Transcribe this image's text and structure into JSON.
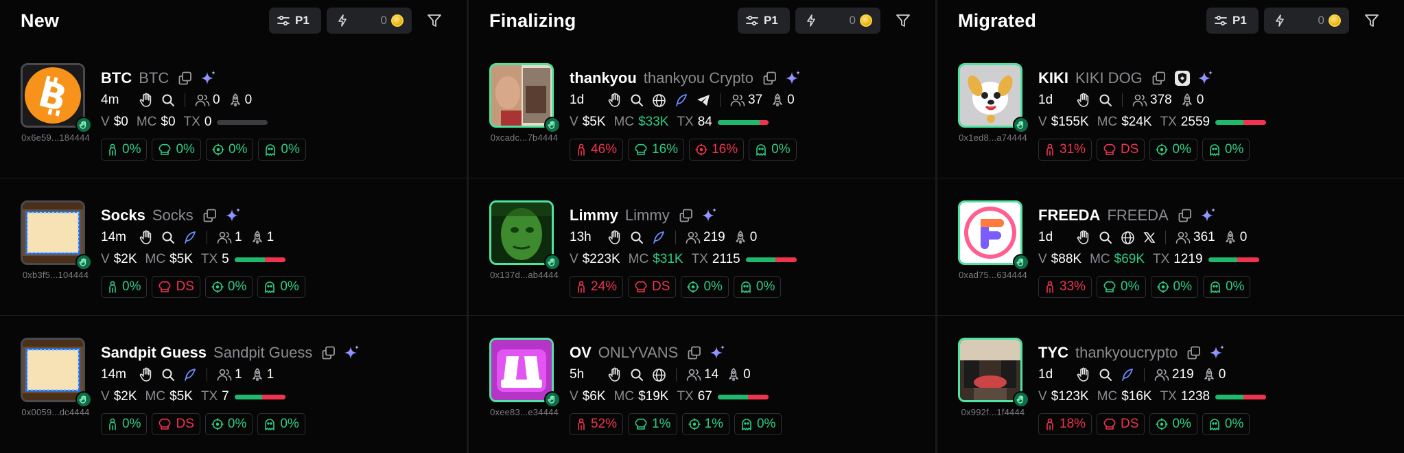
{
  "toolbar": {
    "preset_label": "P1",
    "bolt_value": "0"
  },
  "columns": [
    {
      "title": "New",
      "tokens": [
        {
          "ticker": "BTC",
          "name": "BTC",
          "address": "0x6e59...184444",
          "age": "4m",
          "socials": [
            "search"
          ],
          "holders": "0",
          "snipers": "0",
          "v": "$0",
          "mc": "$0",
          "mc_green": false,
          "tx": "0",
          "buy_ratio": 0,
          "sell_ratio": 0,
          "chip1": "0%",
          "chip2": "0%",
          "chip3": "0%",
          "chip4": "0%",
          "chip1_neg": false,
          "chip2_neg": false,
          "chip3_neg": false,
          "chip4_neg": false,
          "avatar": "btc",
          "border": "grey",
          "chip2_ds": false
        },
        {
          "ticker": "Socks",
          "name": "Socks",
          "address": "0xb3f5...104444",
          "age": "14m",
          "socials": [
            "search",
            "feather"
          ],
          "holders": "1",
          "snipers": "1",
          "v": "$2K",
          "mc": "$5K",
          "mc_green": false,
          "tx": "5",
          "buy_ratio": 0.6,
          "sell_ratio": 0.4,
          "chip1": "0%",
          "chip2": "DS",
          "chip3": "0%",
          "chip4": "0%",
          "chip1_neg": false,
          "chip2_neg": true,
          "chip3_neg": false,
          "chip4_neg": false,
          "avatar": "paper",
          "border": "grey",
          "chip2_ds": true
        },
        {
          "ticker": "Sandpit Guess",
          "name": "Sandpit Guess",
          "address": "0x0059...dc4444",
          "age": "14m",
          "socials": [
            "search",
            "feather"
          ],
          "holders": "1",
          "snipers": "1",
          "v": "$2K",
          "mc": "$5K",
          "mc_green": false,
          "tx": "7",
          "buy_ratio": 0.55,
          "sell_ratio": 0.45,
          "chip1": "0%",
          "chip2": "DS",
          "chip3": "0%",
          "chip4": "0%",
          "chip1_neg": false,
          "chip2_neg": true,
          "chip3_neg": false,
          "chip4_neg": false,
          "avatar": "paper",
          "border": "grey",
          "chip2_ds": true
        }
      ]
    },
    {
      "title": "Finalizing",
      "tokens": [
        {
          "ticker": "thankyou",
          "name": "thankyou Crypto",
          "address": "0xcadc...7b4444",
          "age": "1d",
          "socials": [
            "search",
            "globe",
            "feather",
            "telegram"
          ],
          "holders": "37",
          "snipers": "0",
          "v": "$5K",
          "mc": "$33K",
          "mc_green": true,
          "tx": "84",
          "buy_ratio": 0.82,
          "sell_ratio": 0.18,
          "chip1": "46%",
          "chip2": "16%",
          "chip3": "16%",
          "chip4": "0%",
          "chip1_neg": true,
          "chip2_neg": false,
          "chip3_neg": true,
          "chip4_neg": false,
          "avatar": "photo1",
          "border": "green",
          "chip2_ds": false
        },
        {
          "ticker": "Limmy",
          "name": "Limmy",
          "address": "0x137d...ab4444",
          "age": "13h",
          "socials": [
            "search",
            "feather"
          ],
          "holders": "219",
          "snipers": "0",
          "v": "$223K",
          "mc": "$31K",
          "mc_green": true,
          "tx": "2115",
          "buy_ratio": 0.58,
          "sell_ratio": 0.42,
          "chip1": "24%",
          "chip2": "DS",
          "chip3": "0%",
          "chip4": "0%",
          "chip1_neg": true,
          "chip2_neg": true,
          "chip3_neg": false,
          "chip4_neg": false,
          "avatar": "limmy",
          "border": "green",
          "chip2_ds": true
        },
        {
          "ticker": "OV",
          "name": "ONLYVANS",
          "address": "0xee83...e34444",
          "age": "5h",
          "socials": [
            "search",
            "globe"
          ],
          "holders": "14",
          "snipers": "0",
          "v": "$6K",
          "mc": "$19K",
          "mc_green": false,
          "tx": "67",
          "buy_ratio": 0.6,
          "sell_ratio": 0.4,
          "chip1": "52%",
          "chip2": "1%",
          "chip3": "1%",
          "chip4": "0%",
          "chip1_neg": true,
          "chip2_neg": false,
          "chip3_neg": false,
          "chip4_neg": false,
          "avatar": "ov",
          "border": "green",
          "chip2_ds": false
        }
      ]
    },
    {
      "title": "Migrated",
      "tokens": [
        {
          "ticker": "KIKI",
          "name": "KIKI DOG",
          "address": "0x1ed8...a74444",
          "age": "1d",
          "socials": [
            "search"
          ],
          "holders": "378",
          "snipers": "0",
          "v": "$155K",
          "mc": "$24K",
          "mc_green": false,
          "tx": "2559",
          "buy_ratio": 0.55,
          "sell_ratio": 0.45,
          "chip1": "31%",
          "chip2": "DS",
          "chip3": "0%",
          "chip4": "0%",
          "chip1_neg": true,
          "chip2_neg": true,
          "chip3_neg": false,
          "chip4_neg": false,
          "avatar": "dog",
          "border": "green",
          "chip2_ds": true,
          "shield": true
        },
        {
          "ticker": "FREEDA",
          "name": "FREEDA",
          "address": "0xad75...634444",
          "age": "1d",
          "socials": [
            "search",
            "globe",
            "x"
          ],
          "holders": "361",
          "snipers": "0",
          "v": "$88K",
          "mc": "$69K",
          "mc_green": true,
          "tx": "1219",
          "buy_ratio": 0.58,
          "sell_ratio": 0.42,
          "chip1": "33%",
          "chip2": "0%",
          "chip3": "0%",
          "chip4": "0%",
          "chip1_neg": true,
          "chip2_neg": false,
          "chip3_neg": false,
          "chip4_neg": false,
          "avatar": "freeda",
          "border": "green",
          "chip2_ds": false
        },
        {
          "ticker": "TYC",
          "name": "thankyoucrypto",
          "address": "0x992f...1f4444",
          "age": "1d",
          "socials": [
            "search",
            "feather"
          ],
          "holders": "219",
          "snipers": "0",
          "v": "$123K",
          "mc": "$16K",
          "mc_green": false,
          "tx": "1238",
          "buy_ratio": 0.55,
          "sell_ratio": 0.45,
          "chip1": "18%",
          "chip2": "DS",
          "chip3": "0%",
          "chip4": "0%",
          "chip1_neg": true,
          "chip2_neg": true,
          "chip3_neg": false,
          "chip4_neg": false,
          "avatar": "room",
          "border": "green",
          "chip2_ds": true
        }
      ]
    }
  ],
  "labels": {
    "v": "V",
    "mc": "MC",
    "tx": "TX"
  },
  "colors": {
    "positive": "#2ecc84",
    "negative": "#f0334f",
    "accent_border": "#4fe3a1",
    "background": "#060607"
  }
}
